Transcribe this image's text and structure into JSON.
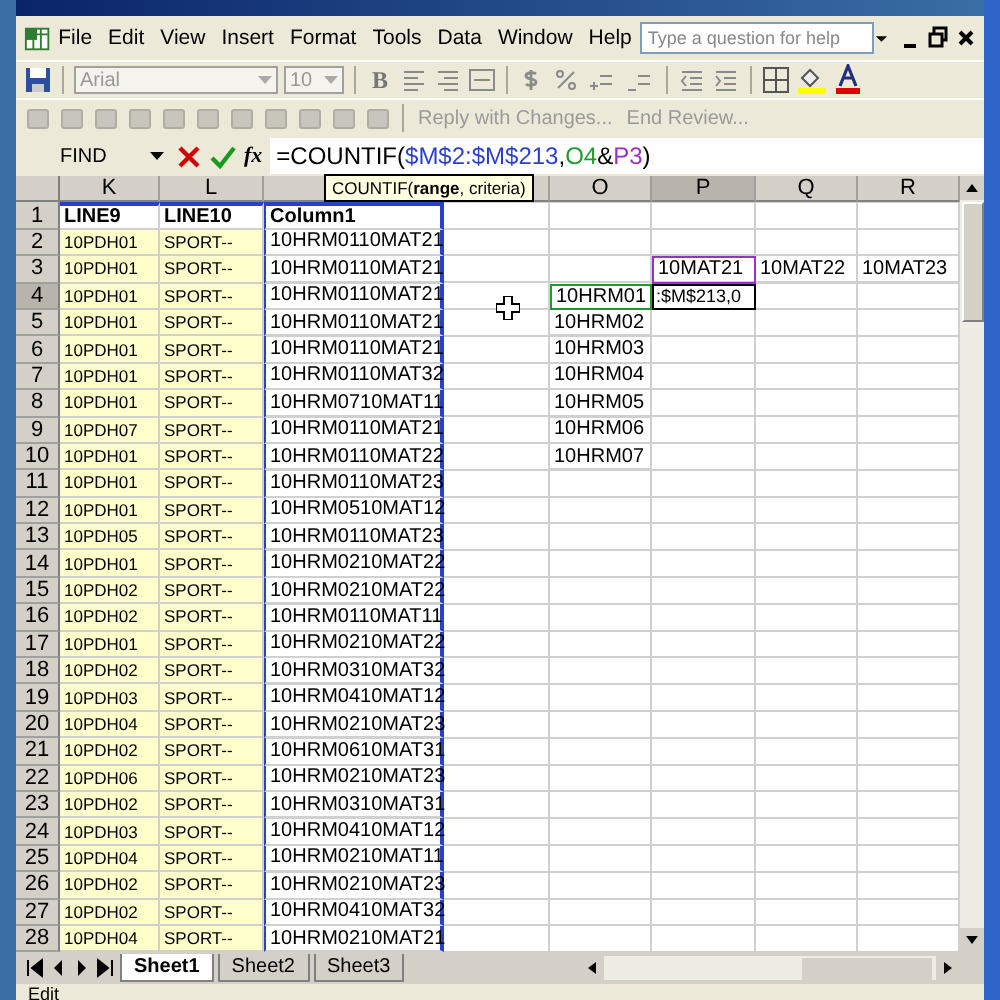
{
  "menu_bar": {
    "items": [
      "File",
      "Edit",
      "View",
      "Insert",
      "Format",
      "Tools",
      "Data",
      "Window",
      "Help"
    ],
    "help_box": {
      "placeholder": "Type a question for help"
    }
  },
  "formatting_toolbar": {
    "font": "Arial",
    "size": "10",
    "bold": "B"
  },
  "reviewing_toolbar": {
    "buttons": [
      {
        "label": "Reply with Changes...",
        "disabled": true
      },
      {
        "label": "End Review...",
        "disabled": true
      }
    ]
  },
  "formula_bar": {
    "name_box": "FIND",
    "fx": "fx",
    "formula_parts": [
      {
        "text": "=COUNTIF("
      },
      {
        "text": "$M$2:$M$213",
        "color": "#2a3fd0"
      },
      {
        "text": ","
      },
      {
        "text": "O4",
        "color": "#1e9a2e"
      },
      {
        "text": "&"
      },
      {
        "text": "P3",
        "color": "#9b30c8"
      },
      {
        "text": ")"
      }
    ]
  },
  "function_tooltip": "COUNTIF(**range**, criteria)",
  "column_headers": [
    {
      "label": "K",
      "selected": false
    },
    {
      "label": "L",
      "selected": false
    },
    {
      "selected": false
    },
    {
      "selected": false
    },
    {
      "label": "O",
      "selected": false
    },
    {
      "label": "P",
      "selected": true
    },
    {
      "label": "Q",
      "selected": false
    },
    {
      "label": "R",
      "selected": false
    }
  ],
  "rows": [
    {
      "number": "1",
      "kind": "header",
      "selected": false,
      "K": "LINE9",
      "L": "LINE10",
      "M": "Column1"
    },
    {
      "number": "2",
      "kind": "data",
      "selected": false,
      "K": "10PDH01",
      "L": "SPORT--",
      "M": "10HRM0110MAT21"
    },
    {
      "number": "3",
      "kind": "data",
      "selected": false,
      "K": "10PDH01",
      "L": "SPORT--",
      "M": "10HRM0110MAT21",
      "P": {
        "text": "10MAT21",
        "color": "#9b30c8"
      },
      "Q": "10MAT22",
      "R": "10MAT23"
    },
    {
      "number": "4",
      "kind": "data",
      "selected": true,
      "K": "10PDH01",
      "L": "SPORT--",
      "M": "10HRM0110MAT21",
      "O": {
        "text": "10HRM01",
        "color": "#1e9a2e"
      },
      "P": {
        "text": ":$M$213,0",
        "kind": "edit"
      }
    },
    {
      "number": "5",
      "kind": "data",
      "selected": false,
      "K": "10PDH01",
      "L": "SPORT--",
      "M": "10HRM0110MAT21",
      "O": "10HRM02"
    },
    {
      "number": "6",
      "kind": "data",
      "selected": false,
      "K": "10PDH01",
      "L": "SPORT--",
      "M": "10HRM0110MAT21",
      "O": "10HRM03"
    },
    {
      "number": "7",
      "kind": "data",
      "selected": false,
      "K": "10PDH01",
      "L": "SPORT--",
      "M": "10HRM0110MAT32",
      "O": "10HRM04"
    },
    {
      "number": "8",
      "kind": "data",
      "selected": false,
      "K": "10PDH01",
      "L": "SPORT--",
      "M": "10HRM0710MAT11",
      "O": "10HRM05"
    },
    {
      "number": "9",
      "kind": "data",
      "selected": false,
      "K": "10PDH07",
      "L": "SPORT--",
      "M": "10HRM0110MAT21",
      "O": "10HRM06"
    },
    {
      "number": "10",
      "kind": "data",
      "selected": false,
      "K": "10PDH01",
      "L": "SPORT--",
      "M": "10HRM0110MAT22",
      "O": "10HRM07"
    },
    {
      "number": "11",
      "kind": "data",
      "selected": false,
      "K": "10PDH01",
      "L": "SPORT--",
      "M": "10HRM0110MAT23"
    },
    {
      "number": "12",
      "kind": "data",
      "selected": false,
      "K": "10PDH01",
      "L": "SPORT--",
      "M": "10HRM0510MAT12"
    },
    {
      "number": "13",
      "kind": "data",
      "selected": false,
      "K": "10PDH05",
      "L": "SPORT--",
      "M": "10HRM0110MAT23"
    },
    {
      "number": "14",
      "kind": "data",
      "selected": false,
      "K": "10PDH01",
      "L": "SPORT--",
      "M": "10HRM0210MAT22"
    },
    {
      "number": "15",
      "kind": "data",
      "selected": false,
      "K": "10PDH02",
      "L": "SPORT--",
      "M": "10HRM0210MAT22"
    },
    {
      "number": "16",
      "kind": "data",
      "selected": false,
      "K": "10PDH02",
      "L": "SPORT--",
      "M": "10HRM0110MAT11"
    },
    {
      "number": "17",
      "kind": "data",
      "selected": false,
      "K": "10PDH01",
      "L": "SPORT--",
      "M": "10HRM0210MAT22"
    },
    {
      "number": "18",
      "kind": "data",
      "selected": false,
      "K": "10PDH02",
      "L": "SPORT--",
      "M": "10HRM0310MAT32"
    },
    {
      "number": "19",
      "kind": "data",
      "selected": false,
      "K": "10PDH03",
      "L": "SPORT--",
      "M": "10HRM0410MAT12"
    },
    {
      "number": "20",
      "kind": "data",
      "selected": false,
      "K": "10PDH04",
      "L": "SPORT--",
      "M": "10HRM0210MAT23"
    },
    {
      "number": "21",
      "kind": "data",
      "selected": false,
      "K": "10PDH02",
      "L": "SPORT--",
      "M": "10HRM0610MAT31"
    },
    {
      "number": "22",
      "kind": "data",
      "selected": false,
      "K": "10PDH06",
      "L": "SPORT--",
      "M": "10HRM0210MAT23"
    },
    {
      "number": "23",
      "kind": "data",
      "selected": false,
      "K": "10PDH02",
      "L": "SPORT--",
      "M": "10HRM0310MAT31"
    },
    {
      "number": "24",
      "kind": "data",
      "selected": false,
      "K": "10PDH03",
      "L": "SPORT--",
      "M": "10HRM0410MAT12"
    },
    {
      "number": "25",
      "kind": "data",
      "selected": false,
      "K": "10PDH04",
      "L": "SPORT--",
      "M": "10HRM0210MAT11"
    },
    {
      "number": "26",
      "kind": "data",
      "selected": false,
      "K": "10PDH02",
      "L": "SPORT--",
      "M": "10HRM0210MAT23"
    },
    {
      "number": "27",
      "kind": "data",
      "selected": false,
      "K": "10PDH02",
      "L": "SPORT--",
      "M": "10HRM0410MAT32"
    },
    {
      "number": "28",
      "kind": "data",
      "selected": false,
      "K": "10PDH04",
      "L": "SPORT--",
      "M": "10HRM0210MAT21"
    }
  ],
  "sheet_tabs": [
    {
      "label": "Sheet1",
      "selected": true
    },
    {
      "label": "Sheet2",
      "selected": false
    },
    {
      "label": "Sheet3",
      "selected": false
    }
  ],
  "status_bar": "Edit"
}
